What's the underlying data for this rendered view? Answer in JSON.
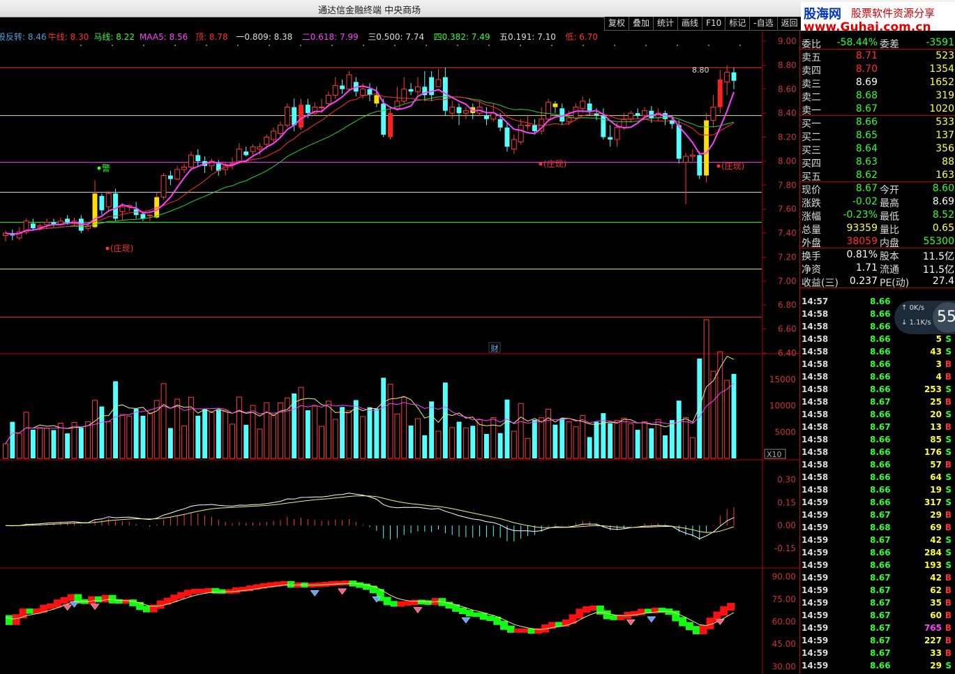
{
  "app": {
    "title": "通达信金融终端  中央商场"
  },
  "toolbar": {
    "items": [
      "复权",
      "叠加",
      "统计",
      "画线",
      "F10",
      "标记",
      "-自选",
      "返回"
    ]
  },
  "logo": {
    "name": "股海网",
    "sub": "股票软件资源分享",
    "url": "www.Guhai.com.cn"
  },
  "indicator_legend": [
    {
      "text": "股反转: 8.46",
      "color": "#4aa0d8"
    },
    {
      "text": "牛线: 8.30",
      "color": "#ff3030"
    },
    {
      "text": "马线: 8.22",
      "color": "#30ff30"
    },
    {
      "text": "MAA5: 8.56",
      "color": "#ff40ff"
    },
    {
      "text": "顶: 8.78",
      "color": "#ff3030"
    },
    {
      "text": "一0.809: 8.38",
      "color": "#dddddd"
    },
    {
      "text": "二0.618: 7.99",
      "color": "#ff40ff"
    },
    {
      "text": "三0.500: 7.74",
      "color": "#dddddd"
    },
    {
      "text": "四0.382: 7.49",
      "color": "#30ff30"
    },
    {
      "text": "五0.191: 7.10",
      "color": "#dddddd"
    },
    {
      "text": "低: 6.70",
      "color": "#ff3030"
    }
  ],
  "main_axis_labels": [
    "9.00",
    "8.80",
    "8.60",
    "8.40",
    "8.20",
    "8.00",
    "7.80",
    "7.60",
    "7.40",
    "7.20",
    "7.00",
    "6.80",
    "6.60",
    "6.40"
  ],
  "volume_axis_labels": [
    "15000",
    "10000",
    "5000"
  ],
  "volume_unit": "X10",
  "macd_axis_labels": [
    "0.30",
    "0.15",
    "0.00",
    "-0.15"
  ],
  "kdj_axis_labels": [
    "90.00",
    "75.00",
    "60.00",
    "45.00",
    "30.00"
  ],
  "annotations": {
    "zhuang1": "(庄现)",
    "zhuang2": "(庄现)",
    "zhuang3": "(庄现)",
    "warn": "警",
    "cai": "财",
    "peak": "8.80"
  },
  "chart_data": {
    "type": "candlestick",
    "price_range": [
      6.4,
      9.0
    ],
    "levels": [
      {
        "name": "顶",
        "value": 8.78,
        "color": "#ff3030"
      },
      {
        "name": "一0.809",
        "value": 8.38,
        "color": "#e0e080"
      },
      {
        "name": "二0.618",
        "value": 7.99,
        "color": "#ff40ff"
      },
      {
        "name": "三0.500",
        "value": 7.74,
        "color": "#e0e0e0"
      },
      {
        "name": "四0.382",
        "value": 7.49,
        "color": "#30ff30"
      },
      {
        "name": "五0.191",
        "value": 7.1,
        "color": "#e0e080"
      },
      {
        "name": "低",
        "value": 6.7,
        "color": "#ff3030"
      }
    ],
    "candles": [
      [
        7.38,
        7.4,
        7.42,
        7.33
      ],
      [
        7.4,
        7.38,
        7.43,
        7.34
      ],
      [
        7.36,
        7.41,
        7.45,
        7.34
      ],
      [
        7.41,
        7.5,
        7.52,
        7.39
      ],
      [
        7.48,
        7.44,
        7.52,
        7.42
      ],
      [
        7.45,
        7.46,
        7.48,
        7.42
      ],
      [
        7.47,
        7.49,
        7.52,
        7.44
      ],
      [
        7.49,
        7.47,
        7.52,
        7.45
      ],
      [
        7.47,
        7.5,
        7.53,
        7.46
      ],
      [
        7.52,
        7.49,
        7.55,
        7.47
      ],
      [
        7.48,
        7.5,
        7.53,
        7.46
      ],
      [
        7.52,
        7.42,
        7.55,
        7.4
      ],
      [
        7.44,
        7.46,
        7.49,
        7.42
      ],
      [
        7.45,
        7.73,
        7.84,
        7.44
      ],
      [
        7.71,
        7.59,
        7.73,
        7.55
      ],
      [
        7.62,
        7.73,
        7.75,
        7.58
      ],
      [
        7.73,
        7.52,
        7.77,
        7.5
      ],
      [
        7.58,
        7.62,
        7.65,
        7.51
      ],
      [
        7.62,
        7.63,
        7.64,
        7.58
      ],
      [
        7.6,
        7.55,
        7.66,
        7.52
      ],
      [
        7.56,
        7.52,
        7.58,
        7.5
      ],
      [
        7.55,
        7.55,
        7.56,
        7.5
      ],
      [
        7.53,
        7.7,
        7.74,
        7.52
      ],
      [
        7.7,
        7.88,
        7.9,
        7.68
      ],
      [
        7.88,
        7.85,
        7.92,
        7.8
      ],
      [
        7.85,
        7.93,
        7.96,
        7.84
      ],
      [
        7.93,
        7.95,
        7.98,
        7.9
      ],
      [
        7.95,
        8.05,
        8.08,
        7.92
      ],
      [
        8.05,
        8.0,
        8.1,
        7.96
      ],
      [
        8.0,
        7.96,
        8.04,
        7.9
      ],
      [
        7.96,
        8.0,
        8.02,
        7.92
      ],
      [
        7.98,
        7.92,
        8.01,
        7.88
      ],
      [
        7.93,
        7.96,
        7.99,
        7.88
      ],
      [
        7.98,
        7.98,
        8.03,
        7.93
      ],
      [
        8.0,
        8.1,
        8.15,
        7.98
      ],
      [
        8.08,
        8.05,
        8.12,
        8.04
      ],
      [
        8.08,
        8.12,
        8.14,
        8.05
      ],
      [
        8.1,
        8.12,
        8.15,
        8.05
      ],
      [
        8.14,
        8.2,
        8.22,
        8.1
      ],
      [
        8.18,
        8.25,
        8.28,
        8.15
      ],
      [
        8.23,
        8.3,
        8.33,
        8.2
      ],
      [
        8.3,
        8.45,
        8.48,
        8.28
      ],
      [
        8.45,
        8.3,
        8.52,
        8.25
      ],
      [
        8.28,
        8.47,
        8.52,
        8.26
      ],
      [
        8.47,
        8.4,
        8.52,
        8.36
      ],
      [
        8.4,
        8.45,
        8.49,
        8.38
      ],
      [
        8.45,
        8.45,
        8.52,
        8.4
      ],
      [
        8.48,
        8.55,
        8.58,
        8.45
      ],
      [
        8.55,
        8.63,
        8.7,
        8.52
      ],
      [
        8.63,
        8.6,
        8.68,
        8.56
      ],
      [
        8.6,
        8.72,
        8.75,
        8.58
      ],
      [
        8.66,
        8.58,
        8.7,
        8.54
      ],
      [
        8.55,
        8.6,
        8.65,
        8.52
      ],
      [
        8.6,
        8.55,
        8.65,
        8.5
      ],
      [
        8.55,
        8.48,
        8.62,
        8.45
      ],
      [
        8.48,
        8.22,
        8.52,
        8.2
      ],
      [
        8.2,
        8.4,
        8.45,
        8.18
      ],
      [
        8.44,
        8.5,
        8.62,
        8.42
      ],
      [
        8.5,
        8.6,
        8.7,
        8.48
      ],
      [
        8.6,
        8.58,
        8.65,
        8.55
      ],
      [
        8.58,
        8.62,
        8.7,
        8.55
      ],
      [
        8.62,
        8.55,
        8.75,
        8.5
      ],
      [
        8.7,
        8.55,
        8.75,
        8.5
      ],
      [
        8.62,
        8.68,
        8.77,
        8.62
      ],
      [
        8.7,
        8.42,
        8.78,
        8.38
      ],
      [
        8.4,
        8.45,
        8.5,
        8.35
      ],
      [
        8.45,
        8.4,
        8.48,
        8.3
      ],
      [
        8.4,
        8.42,
        8.45,
        8.35
      ],
      [
        8.45,
        8.4,
        8.48,
        8.35
      ],
      [
        8.4,
        8.45,
        8.5,
        8.38
      ],
      [
        8.38,
        8.35,
        8.45,
        8.3
      ],
      [
        8.35,
        8.4,
        8.48,
        8.33
      ],
      [
        8.35,
        8.28,
        8.4,
        8.25
      ],
      [
        8.28,
        8.12,
        8.32,
        8.08
      ],
      [
        8.1,
        8.18,
        8.22,
        8.06
      ],
      [
        8.16,
        8.3,
        8.35,
        8.14
      ],
      [
        8.3,
        8.3,
        8.38,
        8.26
      ],
      [
        8.3,
        8.25,
        8.35,
        8.22
      ],
      [
        8.25,
        8.35,
        8.45,
        8.22
      ],
      [
        8.35,
        8.49,
        8.52,
        8.33
      ],
      [
        8.48,
        8.45,
        8.5,
        8.4
      ],
      [
        8.44,
        8.33,
        8.48,
        8.3
      ],
      [
        8.33,
        8.36,
        8.42,
        8.3
      ],
      [
        8.36,
        8.45,
        8.48,
        8.34
      ],
      [
        8.44,
        8.5,
        8.54,
        8.4
      ],
      [
        8.48,
        8.42,
        8.52,
        8.38
      ],
      [
        8.4,
        8.38,
        8.44,
        8.34
      ],
      [
        8.38,
        8.2,
        8.44,
        8.18
      ],
      [
        8.2,
        8.18,
        8.3,
        8.12
      ],
      [
        8.18,
        8.28,
        8.32,
        8.12
      ],
      [
        8.28,
        8.35,
        8.4,
        8.26
      ],
      [
        8.35,
        8.4,
        8.42,
        8.32
      ],
      [
        8.4,
        8.38,
        8.44,
        8.35
      ],
      [
        8.38,
        8.42,
        8.45,
        8.35
      ],
      [
        8.42,
        8.36,
        8.46,
        8.32
      ],
      [
        8.36,
        8.4,
        8.44,
        8.33
      ],
      [
        8.4,
        8.35,
        8.42,
        8.3
      ],
      [
        8.34,
        8.31,
        8.38,
        8.27
      ],
      [
        8.3,
        8.02,
        8.34,
        7.98
      ],
      [
        7.99,
        8.04,
        8.07,
        7.64
      ],
      [
        8.04,
        8.05,
        8.1,
        8.0
      ],
      [
        8.05,
        7.88,
        8.08,
        7.85
      ],
      [
        7.88,
        8.34,
        8.4,
        7.82
      ],
      [
        8.34,
        8.45,
        8.55,
        8.28
      ],
      [
        8.45,
        8.68,
        8.76,
        8.4
      ],
      [
        8.66,
        8.74,
        8.8,
        8.55
      ],
      [
        8.74,
        8.67,
        8.78,
        8.6
      ]
    ],
    "volume_range": [
      0,
      19000
    ],
    "macd_range": [
      -0.25,
      0.38
    ],
    "kdj_range": [
      25,
      95
    ]
  },
  "quotes": [
    {
      "label": "委比",
      "value": "-58.44%",
      "label2": "委差",
      "value2": "-3591",
      "color": "#30ff30",
      "color2": "#30ff30"
    },
    {
      "label": "卖五",
      "value": "8.71",
      "value2": "523",
      "color": "#ff3030",
      "color2": "#ffff40"
    },
    {
      "label": "卖四",
      "value": "8.70",
      "value2": "1354",
      "color": "#ff3030",
      "color2": "#ffff40"
    },
    {
      "label": "卖三",
      "value": "8.69",
      "value2": "1652",
      "color": "#ffffff",
      "color2": "#ffff40"
    },
    {
      "label": "卖二",
      "value": "8.68",
      "value2": "319",
      "color": "#30ff30",
      "color2": "#ffff40"
    },
    {
      "label": "卖一",
      "value": "8.67",
      "value2": "1020",
      "color": "#30ff30",
      "color2": "#ffff40"
    },
    {
      "label": "买一",
      "value": "8.66",
      "value2": "533",
      "color": "#30ff30",
      "color2": "#ffff40"
    },
    {
      "label": "买二",
      "value": "8.65",
      "value2": "137",
      "color": "#30ff30",
      "color2": "#ffff40"
    },
    {
      "label": "买三",
      "value": "8.64",
      "value2": "356",
      "color": "#30ff30",
      "color2": "#ffff40"
    },
    {
      "label": "买四",
      "value": "8.63",
      "value2": "88",
      "color": "#30ff30",
      "color2": "#ffff40"
    },
    {
      "label": "买五",
      "value": "8.62",
      "value2": "163",
      "color": "#30ff30",
      "color2": "#ffff40"
    },
    {
      "label": "现价",
      "value": "8.67",
      "label2": "今开",
      "value2": "8.60",
      "color": "#30ff30",
      "color2": "#30ff30"
    },
    {
      "label": "涨跌",
      "value": "-0.02",
      "label2": "最高",
      "value2": "8.69",
      "color": "#30ff30",
      "color2": "#ffffff"
    },
    {
      "label": "涨幅",
      "value": "-0.23%",
      "label2": "最低",
      "value2": "8.52",
      "color": "#30ff30",
      "color2": "#30ff30"
    },
    {
      "label": "总量",
      "value": "93359",
      "label2": "量比",
      "value2": "0.65",
      "color": "#ffff40",
      "color2": "#ffff40"
    },
    {
      "label": "外盘",
      "value": "38059",
      "label2": "内盘",
      "value2": "55300",
      "color": "#ff3030",
      "color2": "#30ff30"
    },
    {
      "label": "换手",
      "value": "0.81%",
      "label2": "股本",
      "value2": "11.5亿",
      "color": "#ffffff",
      "color2": "#ffffff"
    },
    {
      "label": "净资",
      "value": "1.71",
      "label2": "流通",
      "value2": "11.5亿",
      "color": "#ffffff",
      "color2": "#ffffff"
    },
    {
      "label": "收益(三)",
      "value": "0.237",
      "label2": "PE(动)",
      "value2": "27.4",
      "color": "#ffffff",
      "color2": "#ffffff"
    }
  ],
  "ticks": [
    {
      "t": "14:57",
      "p": "8.66",
      "v": "",
      "s": ""
    },
    {
      "t": "14:58",
      "p": "8.66",
      "v": "",
      "s": ""
    },
    {
      "t": "14:58",
      "p": "8.66",
      "v": "",
      "s": ""
    },
    {
      "t": "14:58",
      "p": "8.66",
      "v": "5",
      "s": "S"
    },
    {
      "t": "14:58",
      "p": "8.66",
      "v": "43",
      "s": "S"
    },
    {
      "t": "14:58",
      "p": "8.66",
      "v": "3",
      "s": "B"
    },
    {
      "t": "14:58",
      "p": "8.66",
      "v": "4",
      "s": "B"
    },
    {
      "t": "14:58",
      "p": "8.66",
      "v": "253",
      "s": "S"
    },
    {
      "t": "14:58",
      "p": "8.67",
      "v": "25",
      "s": "B"
    },
    {
      "t": "14:58",
      "p": "8.66",
      "v": "20",
      "s": "S"
    },
    {
      "t": "14:58",
      "p": "8.67",
      "v": "13",
      "s": "B"
    },
    {
      "t": "14:58",
      "p": "8.66",
      "v": "85",
      "s": "S"
    },
    {
      "t": "14:58",
      "p": "8.66",
      "v": "176",
      "s": "S"
    },
    {
      "t": "14:58",
      "p": "8.66",
      "v": "57",
      "s": "B"
    },
    {
      "t": "14:58",
      "p": "8.66",
      "v": "64",
      "s": "S"
    },
    {
      "t": "14:58",
      "p": "8.66",
      "v": "19",
      "s": "S"
    },
    {
      "t": "14:59",
      "p": "8.66",
      "v": "317",
      "s": "S"
    },
    {
      "t": "14:59",
      "p": "8.67",
      "v": "29",
      "s": "B"
    },
    {
      "t": "14:59",
      "p": "8.68",
      "v": "69",
      "s": "B"
    },
    {
      "t": "14:59",
      "p": "8.67",
      "v": "42",
      "s": "S"
    },
    {
      "t": "14:59",
      "p": "8.66",
      "v": "284",
      "s": "S"
    },
    {
      "t": "14:59",
      "p": "8.66",
      "v": "193",
      "s": "S"
    },
    {
      "t": "14:59",
      "p": "8.67",
      "v": "42",
      "s": "B"
    },
    {
      "t": "14:59",
      "p": "8.67",
      "v": "62",
      "s": "B"
    },
    {
      "t": "14:59",
      "p": "8.67",
      "v": "35",
      "s": "B"
    },
    {
      "t": "14:59",
      "p": "8.67",
      "v": "60",
      "s": "B"
    },
    {
      "t": "14:59",
      "p": "8.67",
      "v": "765",
      "s": "B"
    },
    {
      "t": "14:59",
      "p": "8.67",
      "v": "227",
      "s": "B"
    },
    {
      "t": "14:59",
      "p": "8.67",
      "v": "33",
      "s": "B"
    },
    {
      "t": "14:59",
      "p": "8.66",
      "v": "29",
      "s": "S"
    }
  ],
  "net": {
    "up": "0K/s",
    "down": "1.1K/s",
    "badge": "55"
  }
}
